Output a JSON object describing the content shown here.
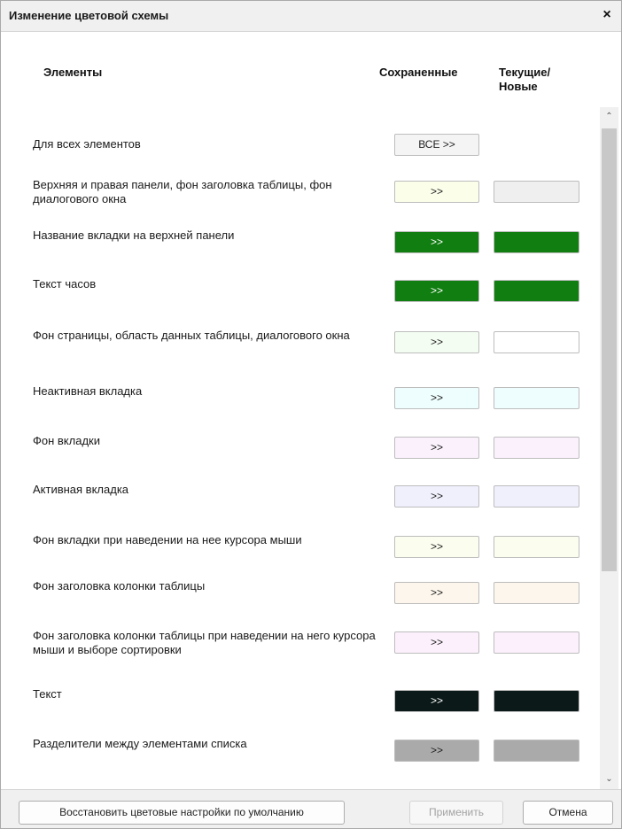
{
  "dialog": {
    "title": "Изменение цветовой схемы",
    "close_glyph": "×"
  },
  "columns": {
    "elements": "Элементы",
    "saved": "Сохраненные",
    "current_line1": "Текущие/",
    "current_line2": "Новые"
  },
  "all_row": {
    "label": "Для всех элементов",
    "button_label": "ВСЕ >>"
  },
  "apply_glyph": ">>",
  "rows": [
    {
      "label": "Верхняя и правая панели, фон заголовка таблицы, фон диалогового окна",
      "saved_color": "#fbfee9",
      "current_color": "#efefef"
    },
    {
      "label": "Название вкладки на верхней панели",
      "saved_color": "#117e11",
      "current_color": "#117e11",
      "dark": true
    },
    {
      "label": "Текст часов",
      "saved_color": "#117e11",
      "current_color": "#117e11",
      "dark": true
    },
    {
      "label": "Фон страницы, область данных таблицы, диалогового окна",
      "saved_color": "#f4fdf1",
      "current_color": "#ffffff"
    },
    {
      "label": "Неактивная вкладка",
      "saved_color": "#eefdfd",
      "current_color": "#eefdfd"
    },
    {
      "label": "Фон вкладки",
      "saved_color": "#fbf1fd",
      "current_color": "#fbf1fd"
    },
    {
      "label": "Активная вкладка",
      "saved_color": "#f0f0fd",
      "current_color": "#f0f0fd"
    },
    {
      "label": "Фон вкладки при наведении на нее курсора мыши",
      "saved_color": "#fbfdee",
      "current_color": "#fbfdee"
    },
    {
      "label": "Фон заголовка колонки таблицы",
      "saved_color": "#fdf6ec",
      "current_color": "#fdf6ec"
    },
    {
      "label": "Фон заголовка колонки таблицы при наведении на него курсора мыши и выборе сортировки",
      "saved_color": "#fcf0fd",
      "current_color": "#fcf0fd"
    },
    {
      "label": "Текст",
      "saved_color": "#0b1a19",
      "current_color": "#0b1a19",
      "dark": true
    },
    {
      "label": "Разделители между элементами списка",
      "saved_color": "#aaaaaa",
      "current_color": "#aaaaaa"
    },
    {
      "label": "",
      "saved_color": "#cccccc",
      "current_color": "#cccccc"
    }
  ],
  "scroll": {
    "up_glyph": "⌃",
    "down_glyph": "⌄"
  },
  "footer": {
    "restore_label": "Восстановить цветовые настройки по умолчанию",
    "apply_label": "Применить",
    "cancel_label": "Отмена"
  }
}
